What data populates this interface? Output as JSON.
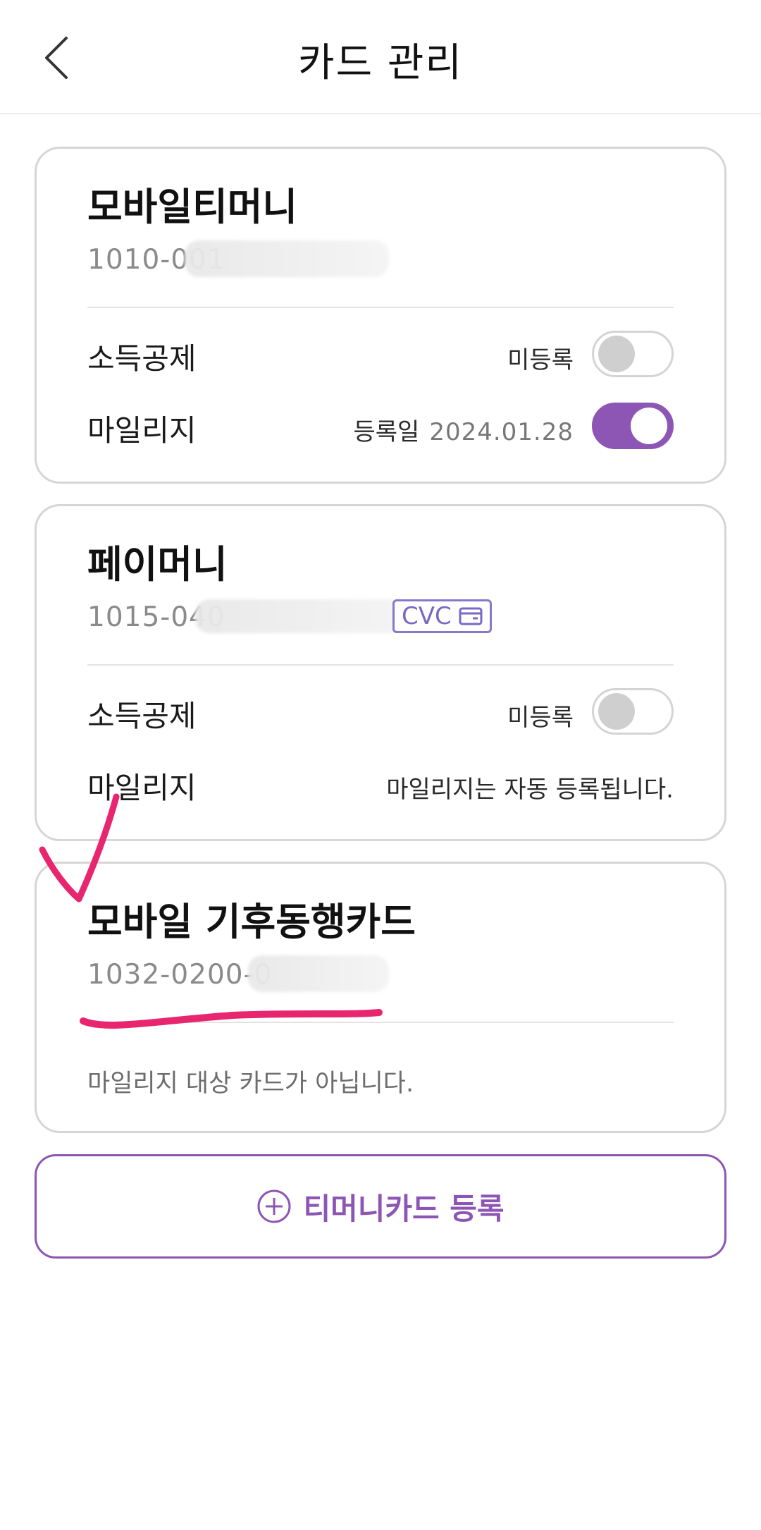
{
  "header": {
    "title": "카드 관리"
  },
  "cards": [
    {
      "name": "모바일티머니",
      "number": "1010-001",
      "rows": [
        {
          "label": "소득공제",
          "status": "미등록",
          "toggle_on": false
        },
        {
          "label": "마일리지",
          "status": "등록일",
          "date": "2024.01.28",
          "toggle_on": true
        }
      ]
    },
    {
      "name": "페이머니",
      "number": "1015-040",
      "cvc_label": "CVC",
      "rows": [
        {
          "label": "소득공제",
          "status": "미등록",
          "toggle_on": false
        },
        {
          "label": "마일리지",
          "status": "마일리지는 자동 등록됩니다."
        }
      ]
    },
    {
      "name": "모바일 기후동행카드",
      "number": "1032-0200-0",
      "note": "마일리지 대상 카드가 아닙니다."
    }
  ],
  "register_button": {
    "label": "티머니카드 등록"
  },
  "icons": [
    "chevron-left-icon",
    "card-icon",
    "plus-circle-icon"
  ],
  "colors": {
    "accent": "#8d55b4",
    "cvc": "#7a68c4",
    "annotation": "#e8256f"
  }
}
